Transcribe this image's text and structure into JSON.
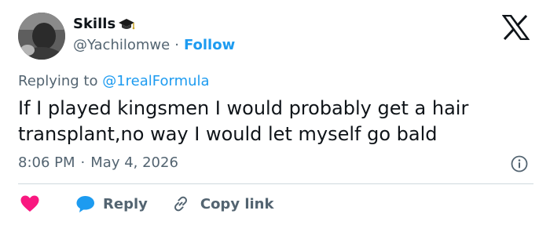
{
  "author": {
    "display_name": "Skills",
    "handle": "@Yachilomwe",
    "separator": "·",
    "follow_label": "Follow"
  },
  "reply_context": {
    "prefix": "Replying to",
    "mention": "@1realFormula"
  },
  "tweet": {
    "text": "If I played kingsmen I would probably get a hair transplant,no way I would let myself go bald",
    "time": "8:06 PM",
    "separator": "·",
    "date": "May 4, 2026"
  },
  "actions": {
    "reply_label": "Reply",
    "copy_link_label": "Copy link"
  },
  "icons": {
    "badge": "graduation-cap-icon",
    "brand": "x-logo-icon",
    "info": "info-icon",
    "like": "heart-icon",
    "reply": "speech-bubble-icon",
    "link": "link-icon"
  },
  "colors": {
    "accent": "#1d9bf0",
    "heart": "#f91880",
    "muted_text": "#536471",
    "text": "#0f1419"
  }
}
